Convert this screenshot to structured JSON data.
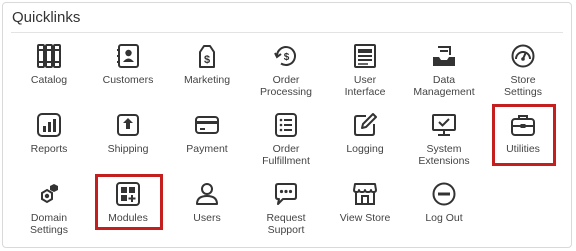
{
  "title": "Quicklinks",
  "highlight_color": "#c41e1e",
  "icon_color": "#333333",
  "rows": [
    [
      {
        "label": "Catalog",
        "icon": "catalog-icon"
      },
      {
        "label": "Customers",
        "icon": "customers-icon"
      },
      {
        "label": "Marketing",
        "icon": "marketing-icon"
      },
      {
        "label": "Order\nProcessing",
        "icon": "order-processing-icon"
      },
      {
        "label": "User\nInterface",
        "icon": "user-interface-icon"
      },
      {
        "label": "Data\nManagement",
        "icon": "data-management-icon"
      },
      {
        "label": "Store\nSettings",
        "icon": "store-settings-icon"
      }
    ],
    [
      {
        "label": "Reports",
        "icon": "reports-icon"
      },
      {
        "label": "Shipping",
        "icon": "shipping-icon"
      },
      {
        "label": "Payment",
        "icon": "payment-icon"
      },
      {
        "label": "Order\nFulfillment",
        "icon": "order-fulfillment-icon"
      },
      {
        "label": "Logging",
        "icon": "logging-icon"
      },
      {
        "label": "System\nExtensions",
        "icon": "system-extensions-icon"
      },
      {
        "label": "Utilities",
        "icon": "utilities-icon",
        "highlighted": true
      }
    ],
    [
      {
        "label": "Domain\nSettings",
        "icon": "domain-settings-icon"
      },
      {
        "label": "Modules",
        "icon": "modules-icon",
        "highlighted": true
      },
      {
        "label": "Users",
        "icon": "users-icon"
      },
      {
        "label": "Request\nSupport",
        "icon": "request-support-icon"
      },
      {
        "label": "View Store",
        "icon": "view-store-icon"
      },
      {
        "label": "Log Out",
        "icon": "log-out-icon"
      }
    ]
  ]
}
